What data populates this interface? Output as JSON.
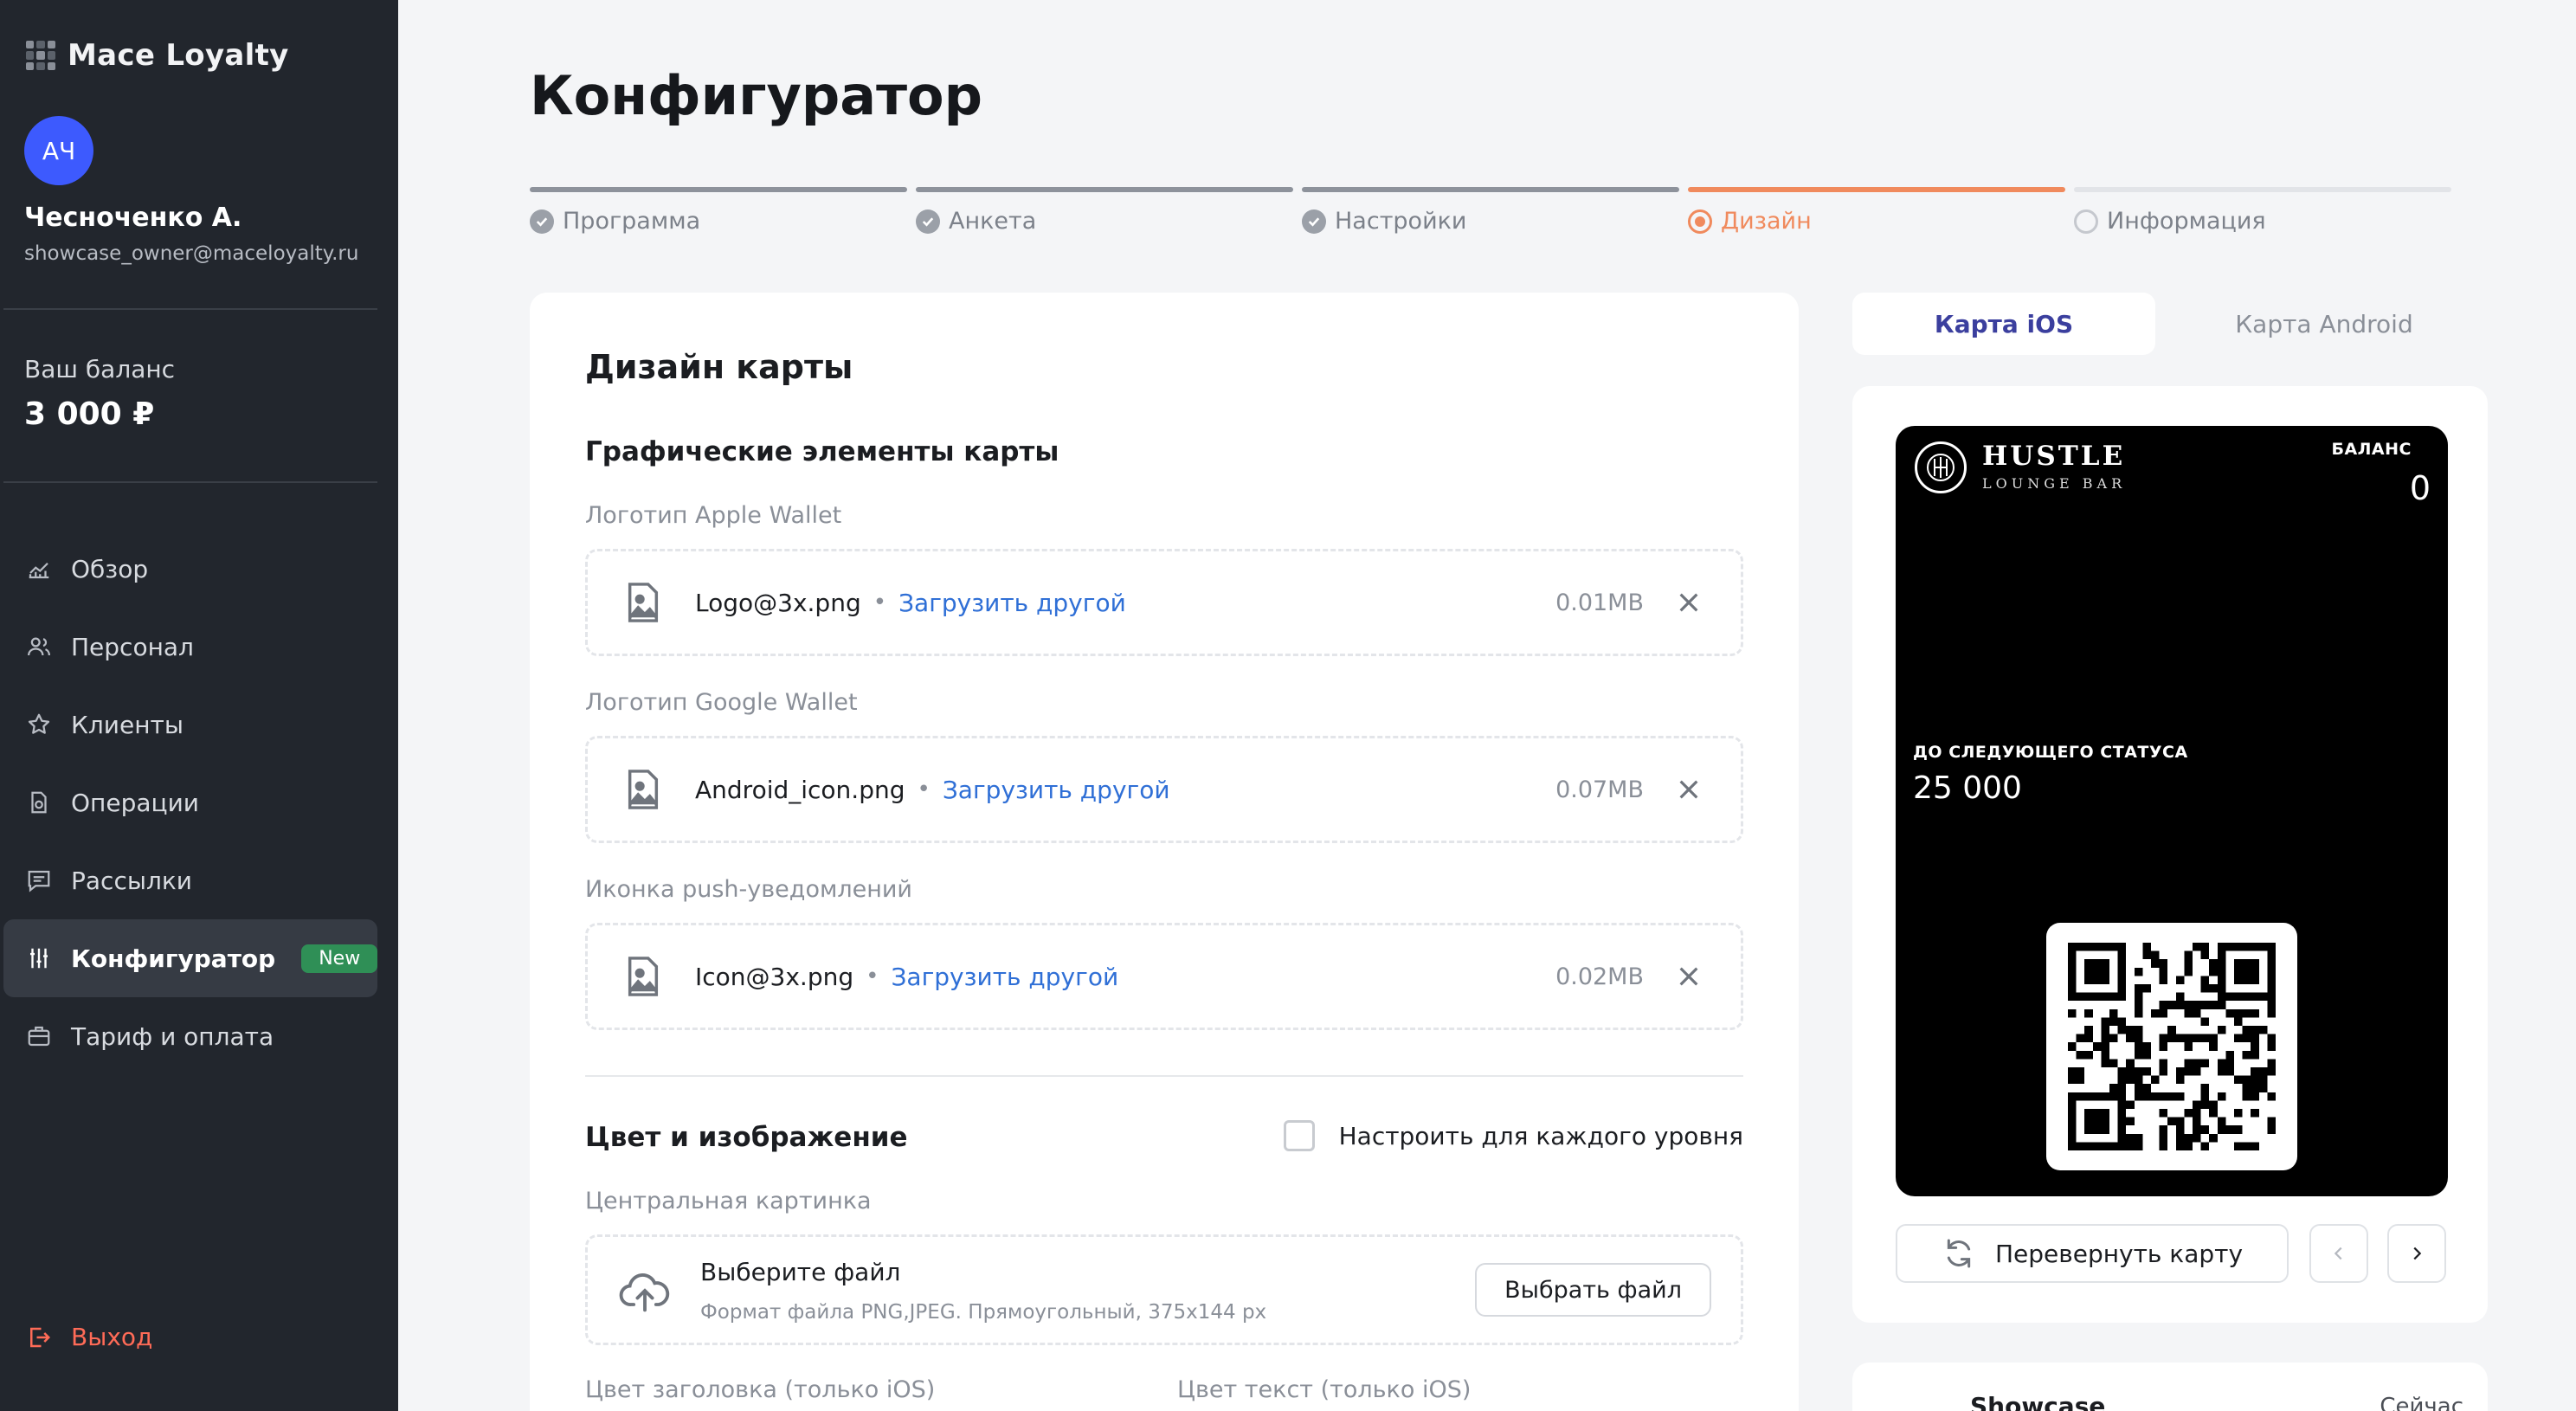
{
  "app": {
    "name": "Mace Loyalty"
  },
  "user": {
    "initials": "АЧ",
    "name": "Чесноченко А.",
    "email": "showcase_owner@maceloyalty.ru"
  },
  "balance": {
    "label": "Ваш баланс",
    "value": "3 000 ₽"
  },
  "nav": {
    "items": [
      {
        "label": "Обзор",
        "icon": "chart-icon"
      },
      {
        "label": "Персонал",
        "icon": "users-icon"
      },
      {
        "label": "Клиенты",
        "icon": "star-icon"
      },
      {
        "label": "Операции",
        "icon": "document-icon"
      },
      {
        "label": "Рассылки",
        "icon": "message-icon"
      },
      {
        "label": "Конфигуратор",
        "icon": "sliders-icon",
        "active": true,
        "badge": "New"
      },
      {
        "label": "Тариф и оплата",
        "icon": "briefcase-icon"
      }
    ],
    "logout": "Выход"
  },
  "page": {
    "title": "Конфигуратор"
  },
  "steps": [
    {
      "label": "Программа",
      "state": "done"
    },
    {
      "label": "Анкета",
      "state": "done"
    },
    {
      "label": "Настройки",
      "state": "done"
    },
    {
      "label": "Дизайн",
      "state": "current"
    },
    {
      "label": "Информация",
      "state": "todo"
    }
  ],
  "design": {
    "title": "Дизайн карты",
    "graphics_title": "Графические элементы карты",
    "files": [
      {
        "label": "Логотип Apple Wallet",
        "name": "Logo@3x.png",
        "action": "Загрузить другой",
        "size": "0.01MB"
      },
      {
        "label": "Логотип Google Wallet",
        "name": "Android_icon.png",
        "action": "Загрузить другой",
        "size": "0.07MB"
      },
      {
        "label": "Иконка push-уведомлений",
        "name": "Icon@3x.png",
        "action": "Загрузить другой",
        "size": "0.02MB"
      }
    ],
    "color_title": "Цвет и изображение",
    "per_level_label": "Настроить для каждого уровня",
    "central_label": "Центральная картинка",
    "upload": {
      "title": "Выберите файл",
      "hint": "Формат файла PNG,JPEG. Прямоугольный, 375x144 px",
      "button": "Выбрать файл"
    },
    "header_color_label": "Цвет заголовка (только iOS)",
    "text_color_label": "Цвет текст (только iOS)"
  },
  "preview": {
    "tabs": [
      {
        "label": "Карта iOS",
        "active": true
      },
      {
        "label": "Карта Android",
        "active": false
      }
    ],
    "card": {
      "brand": "HUSTLE",
      "brand_sub": "LOUNGE BAR",
      "balance_label": "БАЛАНС",
      "balance_value": "0",
      "next_label": "ДО СЛЕДУЮЩЕГО СТАТУСА",
      "next_value": "25 000"
    },
    "flip_button": "Перевернуть карту"
  },
  "notification": {
    "title": "Showcase",
    "time": "Сейчас"
  },
  "colors": {
    "sidebar": "#22262d",
    "accent": "#f08a5d",
    "link": "#2f6fd6",
    "badge": "#2f8f56",
    "avatar": "#3d5afe"
  }
}
